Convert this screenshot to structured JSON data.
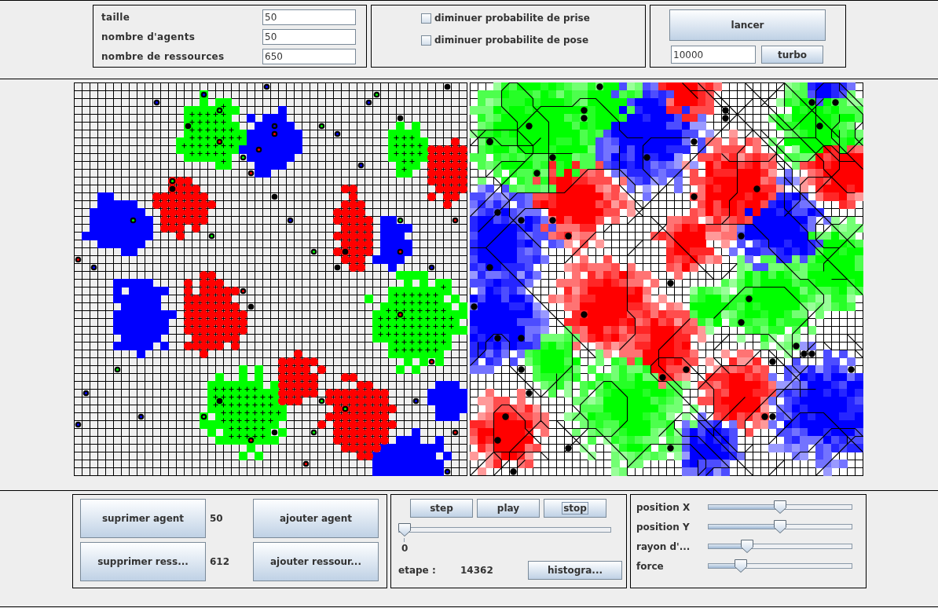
{
  "parameters": {
    "fields": [
      {
        "label": "taille",
        "value": "50"
      },
      {
        "label": "nombre d'agents",
        "value": "50"
      },
      {
        "label": "nombre de ressources",
        "value": "650"
      }
    ]
  },
  "options": [
    {
      "label": "diminuer probabilite de prise",
      "checked": false
    },
    {
      "label": "diminuer probabilite de pose",
      "checked": false
    }
  ],
  "launch": {
    "button": "lancer",
    "turbo_value": "10000",
    "turbo_button": "turbo"
  },
  "edit": {
    "rows": [
      {
        "remove": "suprimer agent",
        "count": "50",
        "add": "ajouter agent"
      },
      {
        "remove": "supprimer ress...",
        "count": "612",
        "add": "ajouter ressour..."
      }
    ]
  },
  "playback": {
    "buttons": [
      {
        "label": "step",
        "focused": false
      },
      {
        "label": "play",
        "focused": false
      },
      {
        "label": "stop",
        "focused": true
      }
    ],
    "slider": {
      "level": 0,
      "tick_label": "0"
    },
    "step_label": "etape :",
    "step_value": "14362",
    "histogram_button": "histogra..."
  },
  "view_controls": [
    {
      "label": "position X",
      "level": 0.5
    },
    {
      "label": "position Y",
      "level": 0.5
    },
    {
      "label": "rayon d'...",
      "level": 0.25
    },
    {
      "label": "force",
      "level": 0.2
    }
  ]
}
